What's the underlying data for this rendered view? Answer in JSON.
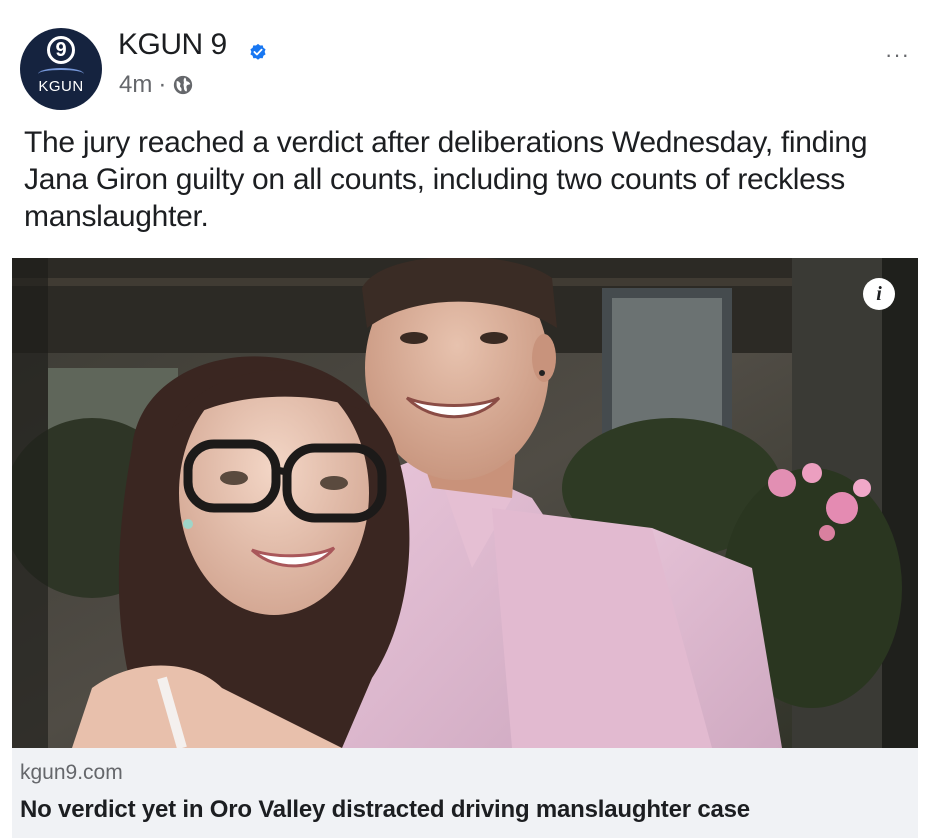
{
  "post": {
    "page": {
      "name": "KGUN 9",
      "avatar_label": "KGUN",
      "avatar_badge": "9",
      "verified": true,
      "time": "4m",
      "separator": "·",
      "audience_icon": "globe-icon"
    },
    "more_menu": "···",
    "caption": "The jury reached a verdict after deliberations Wednesday, finding Jana Giron guilty on all counts, including two counts of reckless manslaughter.",
    "photo": {
      "info_icon": "i"
    },
    "link_preview": {
      "domain": "kgun9.com",
      "title": "No verdict yet in Oro Valley distracted driving manslaughter case"
    }
  },
  "colors": {
    "text_primary": "#1c1e21",
    "text_secondary": "#65676b",
    "verified_blue": "#1877f2",
    "avatar_bg": "#15233f",
    "link_preview_bg": "#f0f2f5"
  }
}
